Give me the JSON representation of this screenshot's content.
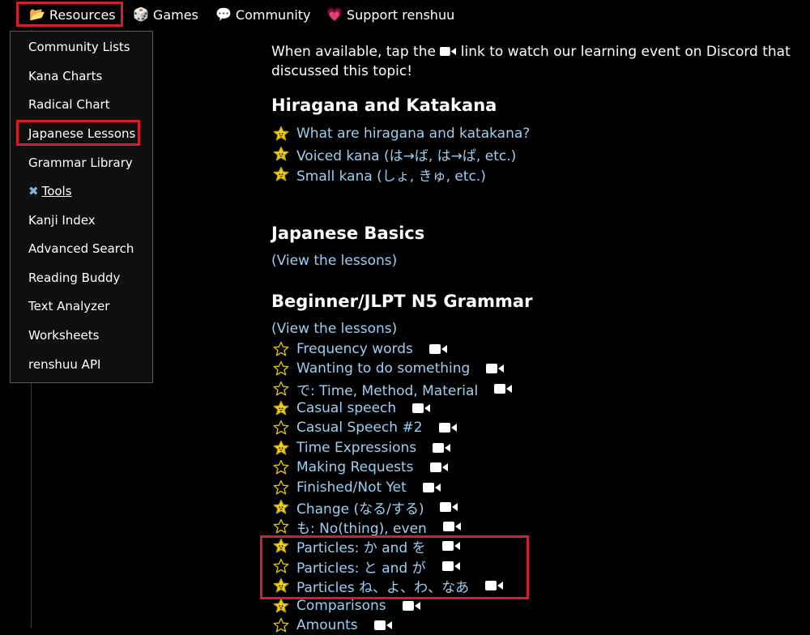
{
  "nav": {
    "items": [
      {
        "label": "Resources",
        "icon": "folder-icon"
      },
      {
        "label": "Games",
        "icon": "dice-icon"
      },
      {
        "label": "Community",
        "icon": "chat-icon"
      },
      {
        "label": "Support renshuu",
        "icon": "heart-icon"
      }
    ]
  },
  "menu": {
    "items": [
      {
        "label": "Community Lists"
      },
      {
        "label": "Kana Charts"
      },
      {
        "label": "Radical Chart"
      },
      {
        "label": "Japanese Lessons"
      },
      {
        "label": "Grammar Library"
      },
      {
        "label": "Tools",
        "icon": "tools-icon"
      },
      {
        "label": "Kanji Index"
      },
      {
        "label": "Advanced Search"
      },
      {
        "label": "Reading Buddy"
      },
      {
        "label": "Text Analyzer"
      },
      {
        "label": "Worksheets"
      },
      {
        "label": "renshuu API"
      }
    ]
  },
  "intro": {
    "before": "When available, tap the ",
    "after": " link to watch our learning event on Discord that discussed this topic!"
  },
  "sections": {
    "hiragana": {
      "title": "Hiragana and Katakana",
      "lessons": [
        {
          "label": "What are hiragana and katakana?",
          "starred": true
        },
        {
          "label": "Voiced kana (は→ば, は→ぱ, etc.)",
          "starred": true
        },
        {
          "label": "Small kana (しょ, きゅ, etc.)",
          "starred": true
        }
      ]
    },
    "basics": {
      "title": "Japanese Basics",
      "view_link": "(View the lessons)"
    },
    "n5": {
      "title": "Beginner/JLPT N5 Grammar",
      "view_link": "(View the lessons)",
      "lessons": [
        {
          "label": "Frequency words",
          "starred": false,
          "video": true
        },
        {
          "label": "Wanting to do something",
          "starred": false,
          "video": true
        },
        {
          "label": "で: Time, Method, Material",
          "starred": false,
          "video": true
        },
        {
          "label": "Casual speech",
          "starred": true,
          "video": true
        },
        {
          "label": "Casual Speech #2",
          "starred": false,
          "video": true
        },
        {
          "label": "Time Expressions",
          "starred": true,
          "video": true
        },
        {
          "label": "Making Requests",
          "starred": false,
          "video": true
        },
        {
          "label": "Finished/Not Yet",
          "starred": false,
          "video": true
        },
        {
          "label": "Change (なる/する)",
          "starred": true,
          "video": true
        },
        {
          "label": "も: No(thing), even",
          "starred": false,
          "video": true
        },
        {
          "label": "Particles: か and を",
          "starred": true,
          "video": true
        },
        {
          "label": "Particles: と and が",
          "starred": false,
          "video": true
        },
        {
          "label": "Particles ね、よ、わ、なあ",
          "starred": true,
          "video": true
        },
        {
          "label": "Comparisons",
          "starred": true,
          "video": true
        },
        {
          "label": "Amounts",
          "starred": false,
          "video": true
        }
      ]
    }
  },
  "colors": {
    "background": "#000000",
    "link": "#9ccff0",
    "highlight_box": "#d0202a",
    "star_filled": "#f3d21c"
  }
}
